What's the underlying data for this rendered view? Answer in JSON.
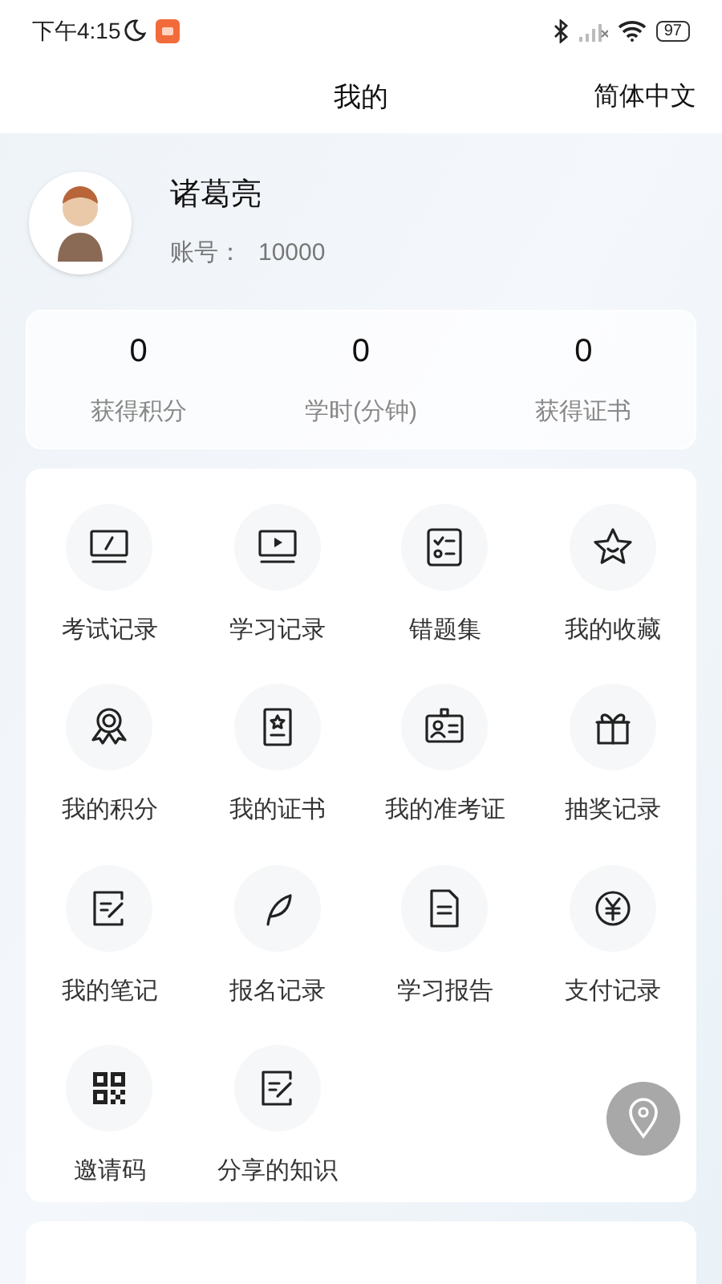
{
  "status_bar": {
    "time": "下午4:15",
    "battery": "97"
  },
  "header": {
    "title": "我的",
    "language": "简体中文"
  },
  "profile": {
    "name": "诸葛亮",
    "account_label": "账号：",
    "account": "10000"
  },
  "stats": [
    {
      "value": "0",
      "label": "获得积分"
    },
    {
      "value": "0",
      "label": "学时(分钟)"
    },
    {
      "value": "0",
      "label": "获得证书"
    }
  ],
  "menu": [
    {
      "label": "考试记录"
    },
    {
      "label": "学习记录"
    },
    {
      "label": "错题集"
    },
    {
      "label": "我的收藏"
    },
    {
      "label": "我的积分"
    },
    {
      "label": "我的证书"
    },
    {
      "label": "我的准考证"
    },
    {
      "label": "抽奖记录"
    },
    {
      "label": "我的笔记"
    },
    {
      "label": "报名记录"
    },
    {
      "label": "学习报告"
    },
    {
      "label": "支付记录"
    },
    {
      "label": "邀请码"
    },
    {
      "label": "分享的知识"
    }
  ]
}
